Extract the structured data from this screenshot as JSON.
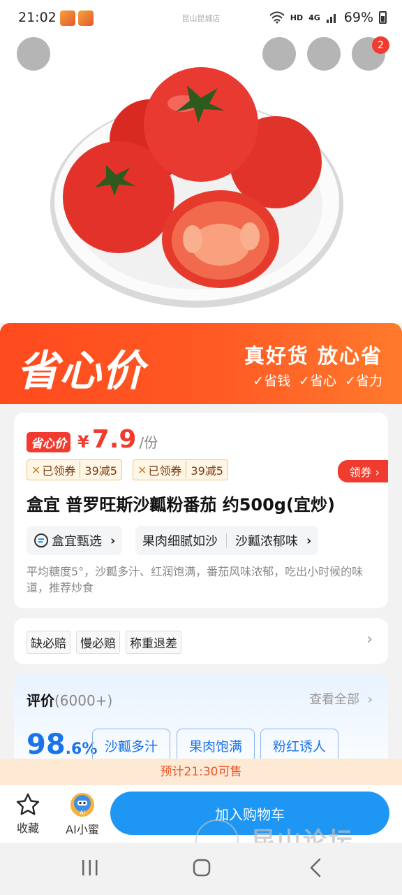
{
  "status_bar": {
    "time": "21:02",
    "center_title": "昆山昆城店",
    "network": "HD",
    "signal": "4G",
    "battery": "69%"
  },
  "header": {
    "back_icon": "chevron-left-icon",
    "search_icon": "search-icon",
    "share_icon": "share-icon",
    "cart_icon": "cart-icon",
    "cart_badge": "2"
  },
  "banner": {
    "brand": "省心价",
    "slogan": "真好货 放心省",
    "points": [
      "✓省钱",
      "✓省心",
      "✓省力"
    ]
  },
  "product": {
    "price_tag": "省心价",
    "currency": "¥",
    "price": "7.9",
    "unit": "/份",
    "coupons": [
      {
        "status": "已领券",
        "rule": "39减5"
      },
      {
        "status": "已领券",
        "rule": "39减5"
      }
    ],
    "get_coupon": "领券",
    "title": "盒宜 普罗旺斯沙瓤粉番茄 约500g(宜炒)",
    "chip_brand": "盒宜甄选",
    "chip_feature_1": "果肉细腻如沙",
    "chip_feature_2": "沙瓤浓郁味",
    "description": "平均糖度5°，沙瓤多汁、红润饱满，番茄风味浓郁，吃出小时候的味道，推荐炒食"
  },
  "services": [
    "缺必赔",
    "慢必赔",
    "称重退差"
  ],
  "reviews": {
    "title": "评价",
    "count": "(6000+)",
    "see_all": "查看全部",
    "rate_int": "98",
    "rate_dec": ".6%",
    "tags": [
      "沙瓤多汁",
      "果肉饱满",
      "粉红诱人"
    ]
  },
  "presale": "预计21:30可售",
  "bottom_bar": {
    "favorite": "收藏",
    "ai": "AI小蜜",
    "add_to_cart": "加入购物车"
  },
  "watermark": "昆山论坛",
  "colors": {
    "accent_red": "#f03b2e",
    "banner_orange": "#ff5a24",
    "primary_blue": "#1e97f4"
  }
}
